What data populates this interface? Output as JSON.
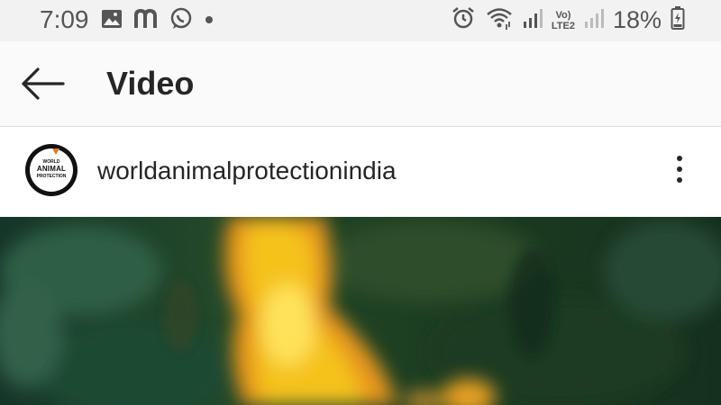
{
  "status_bar": {
    "time": "7:09",
    "volte_line1": "Vo)",
    "volte_line2": "LTE2",
    "battery_percent": "18%",
    "left_icons": [
      "gallery-icon",
      "m-app-icon",
      "whatsapp-icon",
      "dot-icon"
    ],
    "right_icons": [
      "alarm-icon",
      "wifi-icon",
      "signal-icon",
      "signal-icon",
      "battery-icon"
    ]
  },
  "header": {
    "title": "Video",
    "back_icon": "arrow-left-icon"
  },
  "post": {
    "username": "worldanimalprotectionindia",
    "avatar": {
      "line1": "WORLD",
      "line2": "ANIMAL",
      "line3": "PROTECTION"
    },
    "more_icon": "more-vertical-icon"
  },
  "colors": {
    "status_bg": "#f2f2f2",
    "header_bg": "#fafafa",
    "text": "#262626",
    "video_dark_green": "#1c3a26",
    "flame_yellow": "#f5c21a",
    "flame_orange": "#e8961e"
  }
}
